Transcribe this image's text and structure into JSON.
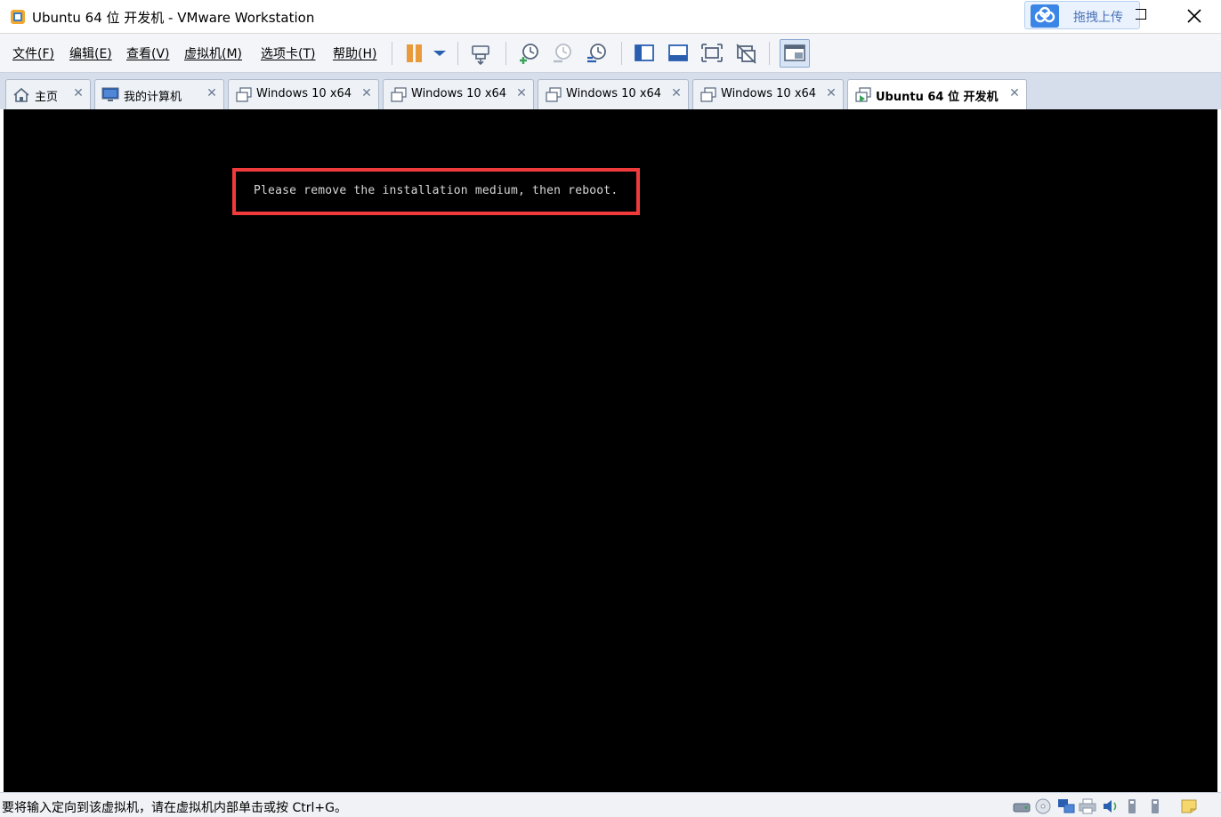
{
  "window": {
    "title": "Ubuntu 64 位 开发机 - VMware Workstation",
    "upload_button": "拖拽上传"
  },
  "menu": {
    "items": [
      "文件(F)",
      "编辑(E)",
      "查看(V)",
      "虚拟机(M)",
      "选项卡(T)",
      "帮助(H)"
    ]
  },
  "tabs": [
    {
      "label": "主页",
      "icon": "home-icon",
      "active": false
    },
    {
      "label": "我的计算机",
      "icon": "computer-icon",
      "active": false
    },
    {
      "label": "Windows 10 x64",
      "icon": "vm-icon",
      "active": false
    },
    {
      "label": "Windows 10 x64",
      "icon": "vm-icon",
      "active": false
    },
    {
      "label": "Windows 10 x64",
      "icon": "vm-icon",
      "active": false
    },
    {
      "label": "Windows 10 x64",
      "icon": "vm-icon",
      "active": false
    },
    {
      "label": "Ubuntu 64 位 开发机",
      "icon": "vm-running-icon",
      "active": true
    }
  ],
  "console": {
    "message": "Please remove the installation medium, then reboot.",
    "highlight_color": "#ef3b3b"
  },
  "statusbar": {
    "text": "要将输入定向到该虚拟机，请在虚拟机内部单击或按 Ctrl+G。"
  },
  "colors": {
    "accent": "#3a85e6",
    "pause": "#e89a3c"
  }
}
